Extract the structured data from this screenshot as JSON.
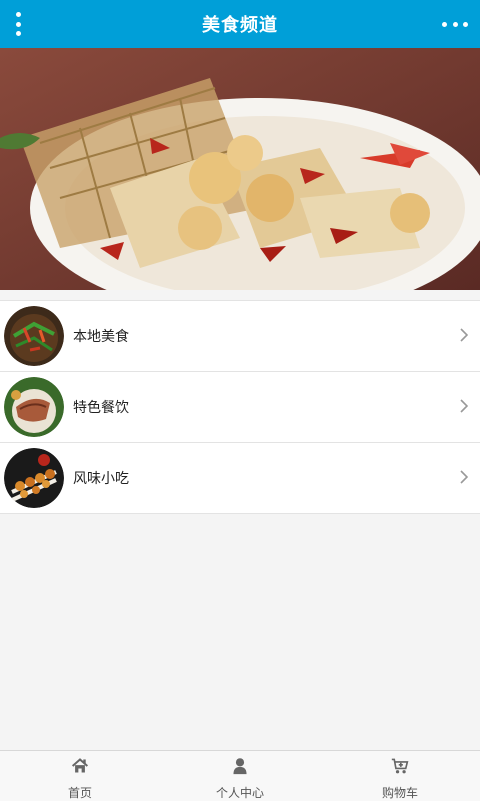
{
  "header": {
    "title": "美食频道",
    "menu_icon": "vertical-dots-icon",
    "more_icon": "more-dots-icon"
  },
  "banner": {
    "slide_count": 1,
    "active_slide": 1
  },
  "categories": [
    {
      "label": "本地美食",
      "icon": "chevron-right-icon"
    },
    {
      "label": "特色餐饮",
      "icon": "chevron-right-icon"
    },
    {
      "label": "风味小吃",
      "icon": "chevron-right-icon"
    }
  ],
  "tabbar": {
    "home": {
      "label": "首页",
      "icon": "home-icon"
    },
    "profile": {
      "label": "个人中心",
      "icon": "user-icon"
    },
    "cart": {
      "label": "购物车",
      "icon": "cart-icon"
    }
  },
  "colors": {
    "header_bg": "#009fd8",
    "page_bg": "#f4f4f4"
  }
}
